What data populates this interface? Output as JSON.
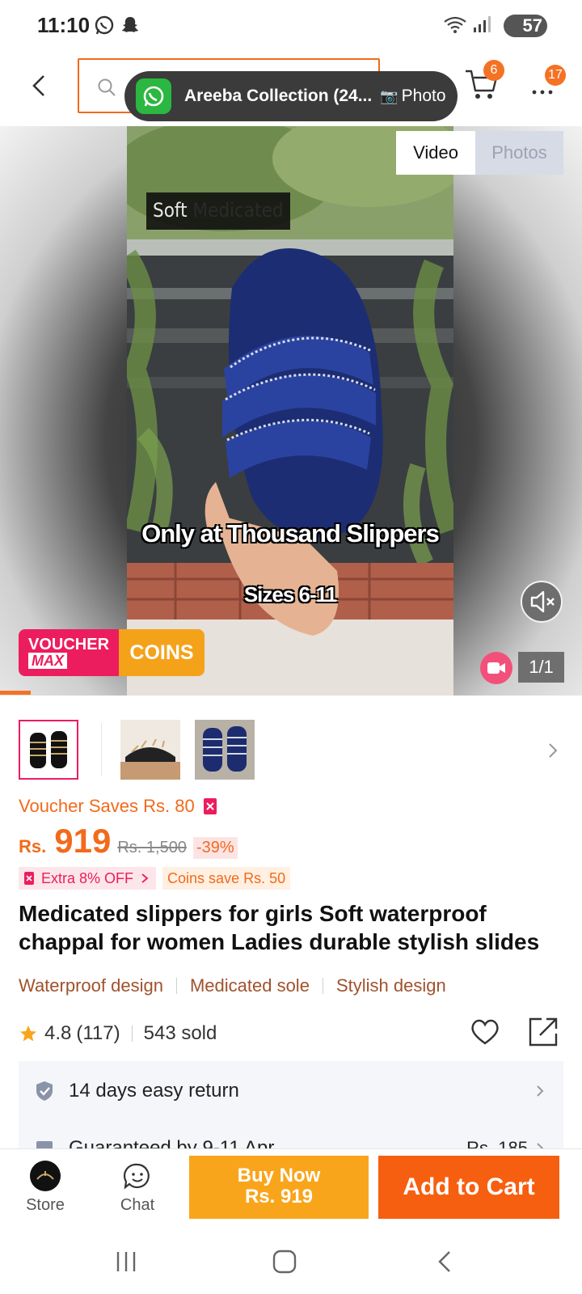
{
  "status_bar": {
    "time": "11:10",
    "battery": "57"
  },
  "header": {
    "cart_badge": "6",
    "more_badge": "17"
  },
  "toast": {
    "title": "Areeba Collection (24...",
    "photo_label": "Photo",
    "photo_emoji": "📷"
  },
  "media": {
    "tab_video": "Video",
    "tab_photos": "Photos",
    "caption_top_bright": "Soft",
    "caption_top_dim": "Medicated",
    "caption_main": "Only at Thousand Slippers",
    "caption_sizes": "Sizes 6-11",
    "counter": "1/1",
    "voucher_banner": {
      "voucher": "VOUCHER",
      "max": "MAX",
      "coins": "COINS"
    }
  },
  "pricing": {
    "voucher_saves": "Voucher Saves Rs. 80",
    "currency": "Rs.",
    "price": "919",
    "original_price": "Rs. 1,500",
    "discount": "-39%",
    "extra_off": "Extra 8% OFF",
    "coins_save": "Coins save Rs. 50"
  },
  "product": {
    "title": "Medicated slippers for girls Soft waterproof chappal for women Ladies durable stylish slides",
    "features": [
      "Waterproof design",
      "Medicated sole",
      "Stylish design"
    ],
    "rating": "4.8",
    "reviews": "(117)",
    "sold": "543 sold"
  },
  "service": {
    "return_text": "14 days easy return",
    "delivery_text": "Guaranteed by 9-11 Apr",
    "delivery_fee": "Rs. 185"
  },
  "bottom_bar": {
    "store_label": "Store",
    "chat_label": "Chat",
    "buy_now_label": "Buy Now",
    "buy_now_price": "Rs. 919",
    "add_to_cart_label": "Add to Cart"
  },
  "colors": {
    "accent": "#f57224",
    "price": "#f26a1b",
    "buy_now": "#f9a51b",
    "add_to_cart": "#f65f0f",
    "voucher_pink": "#ec1d5f"
  }
}
